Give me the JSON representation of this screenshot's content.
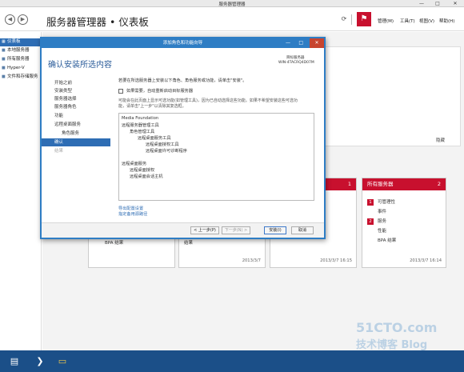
{
  "window": {
    "title": "服务器管理器",
    "minimize": "—",
    "maximize": "□",
    "close": "✕"
  },
  "header": {
    "back_icon": "arrow-left-icon",
    "forward_icon": "arrow-right-icon",
    "breadcrumb": "服务器管理器 • 仪表板",
    "menus": [
      "管理(M)",
      "工具(T)",
      "视图(V)",
      "帮助(H)"
    ]
  },
  "sidebar": {
    "items": [
      {
        "label": "仪表板",
        "icon": "▦"
      },
      {
        "label": "本地服务器",
        "icon": "■"
      },
      {
        "label": "所有服务器",
        "icon": "■"
      },
      {
        "label": "Hyper-V",
        "icon": "■"
      },
      {
        "label": "文件和存储服务",
        "icon": "■"
      }
    ]
  },
  "dashboard": {
    "hide_label": "隐藏",
    "tile_left": {
      "rows": [
        "BPA 结果"
      ]
    },
    "tile_mid": {
      "rows": [
        "结果"
      ],
      "timestamp": "2013/3/7"
    },
    "tile_right_partial": {
      "count": "1",
      "timestamp": "2013/3/7 16:15"
    },
    "tile_all": {
      "title": "所有服务器",
      "count": "2",
      "rows": [
        {
          "badge": "1",
          "label": "可管理性"
        },
        {
          "badge": "",
          "label": "事件"
        },
        {
          "badge": "2",
          "label": "服务"
        },
        {
          "badge": "",
          "label": "性能"
        },
        {
          "badge": "",
          "label": "BPA 结果"
        }
      ],
      "timestamp": "2013/3/7 16:14"
    }
  },
  "dialog": {
    "title": "添加角色和功能向导",
    "heading": "确认安装所选内容",
    "target_label": "目标服务器",
    "target_value": "WIN-4TACRQ4D07M",
    "steps": [
      {
        "label": "开始之前",
        "state": "normal"
      },
      {
        "label": "安装类型",
        "state": "normal"
      },
      {
        "label": "服务器选择",
        "state": "normal"
      },
      {
        "label": "服务器角色",
        "state": "normal"
      },
      {
        "label": "功能",
        "state": "normal"
      },
      {
        "label": "远程桌面服务",
        "state": "normal"
      },
      {
        "label": "角色服务",
        "state": "sub"
      },
      {
        "label": "确认",
        "state": "active"
      },
      {
        "label": "结果",
        "state": "disabled"
      }
    ],
    "intro": "若要在所选服务器上安装以下角色、角色服务或功能，请单击\"安装\"。",
    "restart_checkbox_label": "如果需要，自动重新启动目标服务器",
    "info_line1": "可能会在此页面上显示可选功能(如管理工具)，因为已自动选择这些功能。如果不希望安装这些可选功",
    "info_line2": "能，请单击\"上一步\"以清除其复选框。",
    "features": [
      {
        "text": "Media Foundation",
        "level": 0
      },
      {
        "text": "远程服务器管理工具",
        "level": 0
      },
      {
        "text": "角色管理工具",
        "level": 1
      },
      {
        "text": "远程桌面服务工具",
        "level": 2
      },
      {
        "text": "远程桌面授权工具",
        "level": 3
      },
      {
        "text": "远程桌面许可诊断程序",
        "level": 3
      },
      {
        "text": "",
        "level": 0
      },
      {
        "text": "远程桌面服务",
        "level": 0
      },
      {
        "text": "远程桌面授权",
        "level": 1
      },
      {
        "text": "远程桌面会话主机",
        "level": 1
      }
    ],
    "export_link": "导出配置设置",
    "alt_source_link": "指定备用源路径",
    "buttons": {
      "prev": "< 上一步(P)",
      "next": "下一步(N) >",
      "install": "安装(I)",
      "cancel": "取消"
    }
  },
  "watermark": {
    "line1": "51CTO.com",
    "line2": "技术博客 Blog"
  }
}
